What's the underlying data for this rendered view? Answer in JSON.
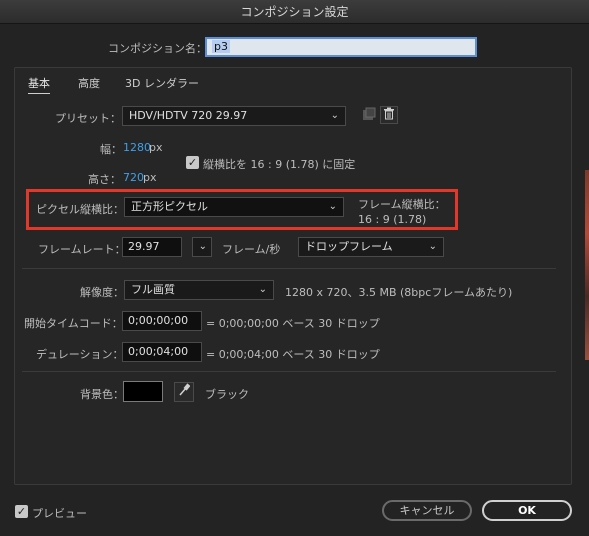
{
  "window": {
    "title": "コンポジション設定"
  },
  "comp_name": {
    "label": "コンポジション名：",
    "value": "p3"
  },
  "tabs": [
    {
      "label": "基本",
      "active": true
    },
    {
      "label": "高度",
      "active": false
    },
    {
      "label": "3D レンダラー",
      "active": false
    }
  ],
  "preset": {
    "label": "プリセット：",
    "value": "HDV/HDTV 720 29.97",
    "save_icon": "save-preset-icon",
    "delete_icon": "trash-icon"
  },
  "width": {
    "label": "幅：",
    "value": "1280",
    "unit": "px"
  },
  "height": {
    "label": "高さ：",
    "value": "720",
    "unit": "px"
  },
  "lock_aspect": {
    "checked": true,
    "label": "縦横比を 16 : 9 (1.78) に固定"
  },
  "pixel_aspect": {
    "label": "ピクセル縦横比：",
    "value": "正方形ピクセル",
    "highlight_color": "#e0392b"
  },
  "frame_aspect": {
    "label": "フレーム縦横比：",
    "value": "16 : 9 (1.78)"
  },
  "frame_rate": {
    "label": "フレームレート：",
    "value": "29.97",
    "unit": "フレーム/秒",
    "drop_value": "ドロップフレーム"
  },
  "resolution": {
    "label": "解像度：",
    "value": "フル画質",
    "info": "1280 x 720、3.5 MB (8bpcフレームあたり)"
  },
  "start_timecode": {
    "label": "開始タイムコード：",
    "value": "0;00;00;00",
    "info": "= 0;00;00;00  ベース 30  ドロップ"
  },
  "duration": {
    "label": "デュレーション：",
    "value": "0;00;04;00",
    "info": "= 0;00;04;00  ベース 30  ドロップ"
  },
  "background": {
    "label": "背景色：",
    "color": "#000000",
    "name": "ブラック",
    "eyedropper_icon": "eyedropper-icon"
  },
  "footer": {
    "preview_label": "プレビュー",
    "preview_checked": true,
    "cancel_label": "キャンセル",
    "ok_label": "OK"
  },
  "colors": {
    "accent_blue": "#3ea0e8",
    "dialog_bg": "#232323"
  }
}
